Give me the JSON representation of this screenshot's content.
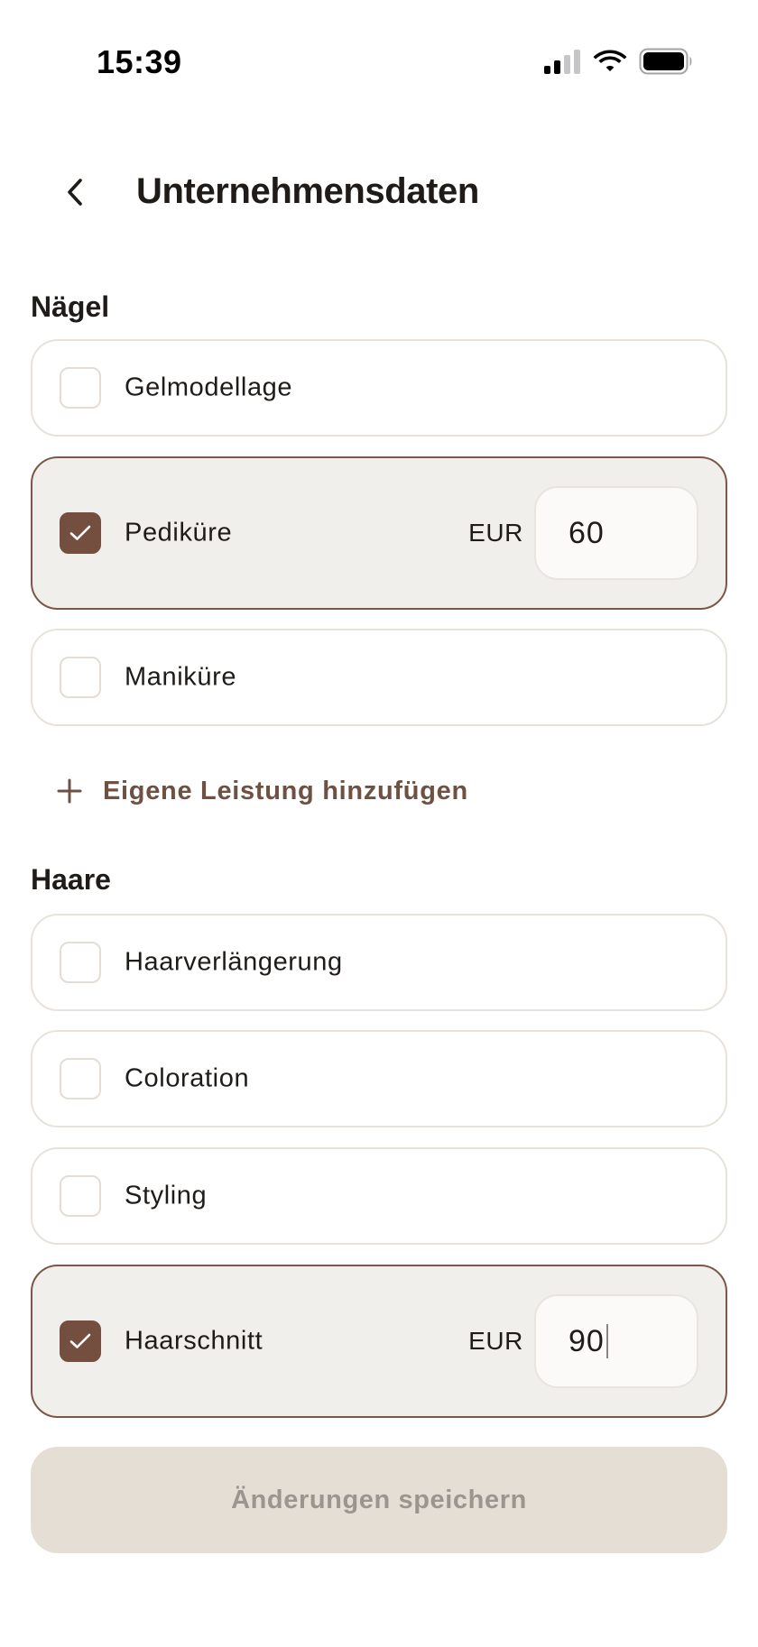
{
  "status_bar": {
    "time": "15:39"
  },
  "header": {
    "title": "Unternehmensdaten"
  },
  "sections": [
    {
      "title": "Nägel",
      "items": [
        {
          "label": "Gelmodellage",
          "checked": false
        },
        {
          "label": "Pediküre",
          "checked": true,
          "currency": "EUR",
          "price": "60"
        },
        {
          "label": "Maniküre",
          "checked": false
        }
      ],
      "add_label": "Eigene Leistung hinzufügen"
    },
    {
      "title": "Haare",
      "items": [
        {
          "label": "Haarverlängerung",
          "checked": false
        },
        {
          "label": "Coloration",
          "checked": false
        },
        {
          "label": "Styling",
          "checked": false
        },
        {
          "label": "Haarschnitt",
          "checked": true,
          "currency": "EUR",
          "price": "90"
        }
      ]
    }
  ],
  "save_button": {
    "label": "Änderungen speichern",
    "enabled": false
  },
  "colors": {
    "accent": "#744f3f",
    "card_border": "#e8e2db",
    "selected_bg": "#f1efec",
    "button_disabled_bg": "#e5ded5",
    "button_disabled_text": "#9b958f"
  },
  "icons": {
    "back": "chevron-left-icon",
    "check": "checkmark-icon",
    "add": "plus-icon",
    "signal": "cellular-signal-icon",
    "wifi": "wifi-icon",
    "battery": "battery-icon"
  }
}
